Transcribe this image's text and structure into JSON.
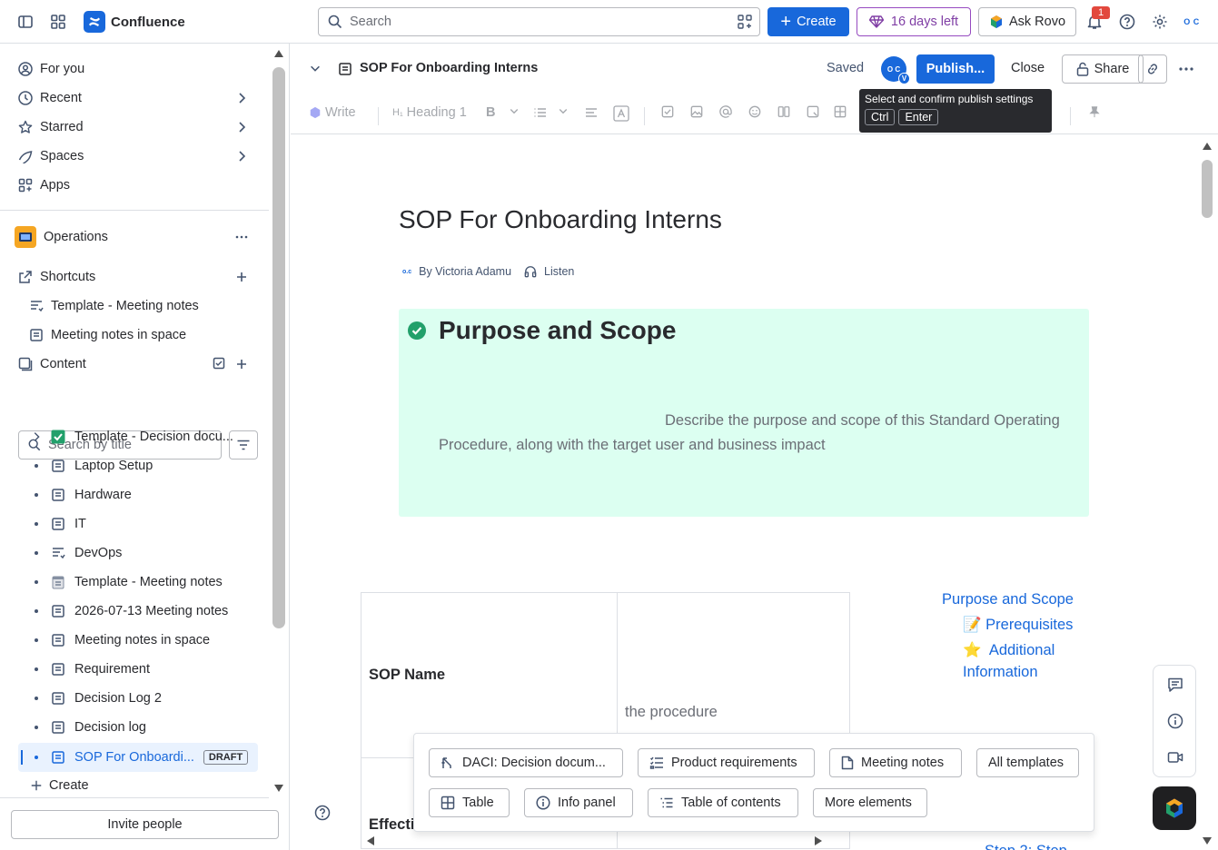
{
  "app": {
    "name": "Confluence"
  },
  "topbar": {
    "search_placeholder": "Search",
    "create_label": "Create",
    "trial_label": "16 days left",
    "rovo_label": "Ask Rovo",
    "notifications_count": "1",
    "user_initials": "O C"
  },
  "sidebar": {
    "nav": [
      {
        "label": "For you"
      },
      {
        "label": "Recent"
      },
      {
        "label": "Starred"
      },
      {
        "label": "Spaces"
      },
      {
        "label": "Apps"
      }
    ],
    "space_name": "Operations",
    "shortcuts_label": "Shortcuts",
    "shortcuts": [
      {
        "label": "Template - Meeting notes"
      },
      {
        "label": "Meeting notes in space"
      }
    ],
    "content_label": "Content",
    "title_search_placeholder": "Search by title",
    "tree": [
      {
        "label": "Template - Decision docu..."
      },
      {
        "label": "Laptop Setup"
      },
      {
        "label": "Hardware"
      },
      {
        "label": "IT"
      },
      {
        "label": "DevOps"
      },
      {
        "label": "Template - Meeting notes"
      },
      {
        "label": "2026-07-13 Meeting notes"
      },
      {
        "label": "Meeting notes in space"
      },
      {
        "label": "Requirement"
      },
      {
        "label": "Decision Log 2"
      },
      {
        "label": "Decision log"
      },
      {
        "label": "SOP For Onboardi...",
        "badge": "DRAFT"
      }
    ],
    "create_label": "Create",
    "invite_label": "Invite people"
  },
  "editor": {
    "breadcrumb_title": "SOP For Onboarding Interns",
    "saved_label": "Saved",
    "avatar_initials": "O C",
    "avatar_badge": "V",
    "publish_label": "Publish...",
    "close_label": "Close",
    "share_label": "Share",
    "toolbar": {
      "write_label": "Write",
      "heading_label": "Heading 1"
    },
    "tooltip": {
      "text": "Select and confirm publish settings",
      "key1": "Ctrl",
      "key2": "Enter"
    }
  },
  "page": {
    "title": "SOP For Onboarding Interns",
    "author": "By Victoria Adamu",
    "listen_label": "Listen",
    "panel_heading": "Purpose and Scope",
    "panel_placeholder": "Describe the purpose and scope of this Standard Operating Procedure, along with the target user and business impact",
    "table": {
      "row1_label": "SOP Name",
      "row1_value": "the procedure",
      "row2_label": "Effecti"
    },
    "toc": [
      {
        "emoji": "",
        "label": "Purpose and Scope"
      },
      {
        "emoji": "📝",
        "label": "Prerequisites"
      },
      {
        "emoji": "⭐",
        "label": "Additional Information"
      }
    ],
    "toc_partial": "Step 2: Step"
  },
  "templates": {
    "row1": [
      {
        "label": "DACI: Decision docum..."
      },
      {
        "label": "Product requirements"
      },
      {
        "label": "Meeting notes"
      },
      {
        "label": "All templates"
      }
    ],
    "row2": [
      {
        "label": "Table"
      },
      {
        "label": "Info panel"
      },
      {
        "label": "Table of contents"
      },
      {
        "label": "More elements"
      }
    ]
  },
  "colors": {
    "brand": "#1868db",
    "panel_bg": "#dcfff1",
    "trial": "#803fa5",
    "selected_bg": "#e9f2fe"
  }
}
